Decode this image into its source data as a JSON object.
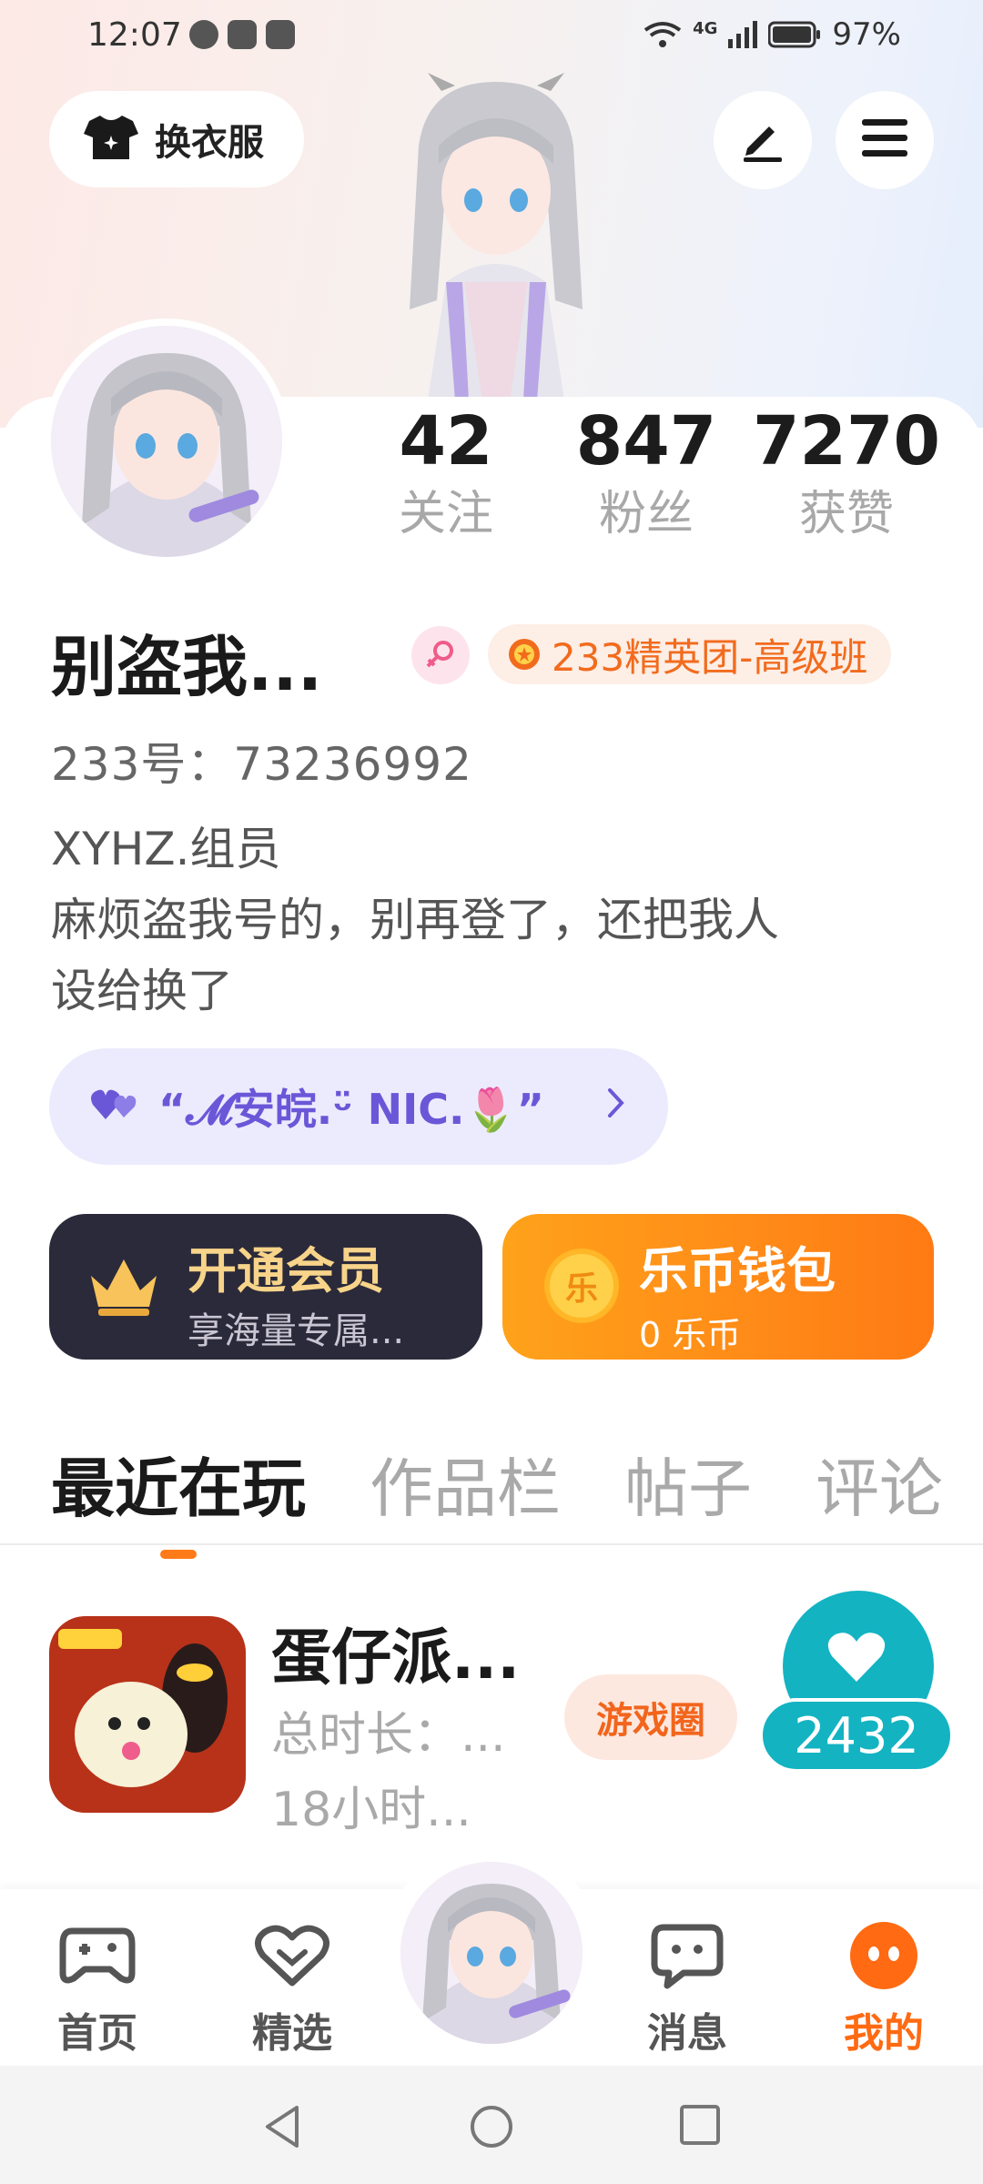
{
  "status_bar": {
    "time": "12:07",
    "network": "4G",
    "battery": "97%"
  },
  "header": {
    "outfit_label": "换衣服"
  },
  "profile": {
    "stats": [
      {
        "value": "42",
        "label": "关注"
      },
      {
        "value": "847",
        "label": "粉丝"
      },
      {
        "value": "7270",
        "label": "获赞"
      }
    ],
    "nickname": "别盗我...",
    "team_badge": "233精英团-高级班",
    "uid": "233号：73236992",
    "bio_lines": [
      "XYHZ.组员",
      "麻烦盗我号的，别再登了，还把我人",
      "设给换了"
    ],
    "group_pill": "“𝓜安皖.ᵕ̈ NIC.🌷”"
  },
  "cards": {
    "vip": {
      "title": "开通会员",
      "subtitle": "享海量专属..."
    },
    "wallet": {
      "title": "乐币钱包",
      "subtitle": "0 乐币",
      "coin_char": "乐"
    }
  },
  "tabs": [
    "最近在玩",
    "作品栏",
    "帖子",
    "评论"
  ],
  "recent_game": {
    "name": "蛋仔派...",
    "meta1": "总时长：...",
    "meta2": "18小时...",
    "circle_label": "游戏圈"
  },
  "like_count": "2432",
  "bottom_nav": [
    {
      "label": "首页",
      "icon": "gamepad-icon"
    },
    {
      "label": "精选",
      "icon": "heart-box-icon"
    },
    {
      "label": "消息",
      "icon": "chat-icon"
    },
    {
      "label": "我的",
      "icon": "profile-dots-icon"
    }
  ],
  "colors": {
    "accent": "#ff6a12",
    "teal": "#13b3c2",
    "purple": "#6a57d8"
  }
}
